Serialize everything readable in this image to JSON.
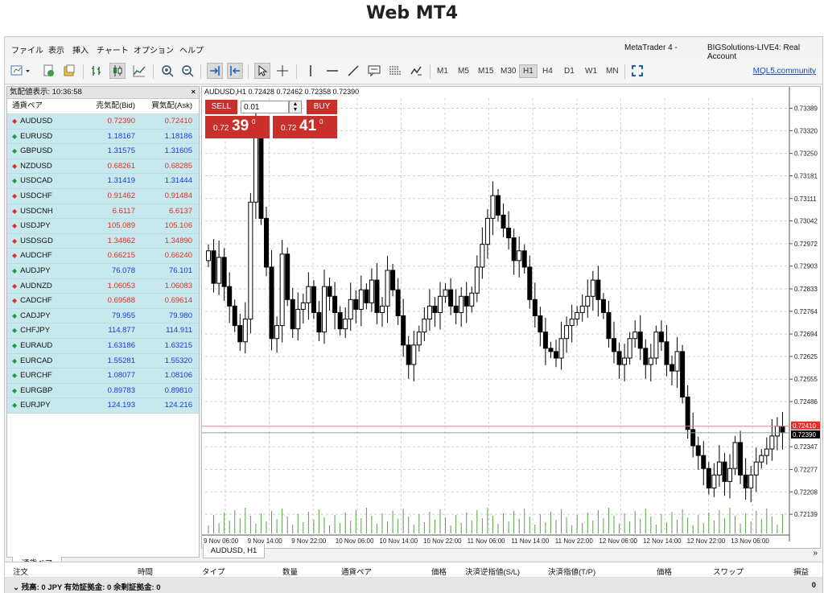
{
  "page_title": "Web MT4",
  "menu": [
    "ファイル",
    "表示",
    "挿入",
    "チャート",
    "オプション",
    "ヘルプ"
  ],
  "account": {
    "platform": "MetaTrader 4 -",
    "server": "BIGSolutions-LIVE4: Real Account"
  },
  "toolbar": {
    "timeframes": [
      "M1",
      "M5",
      "M15",
      "M30",
      "H1",
      "H4",
      "D1",
      "W1",
      "MN"
    ],
    "active_timeframe": "H1",
    "community_link": "MQL5.community"
  },
  "market_watch": {
    "title": "気配値表示: 10:36:58",
    "close": "×",
    "headers": {
      "symbol": "通貨ペア",
      "bid": "売気配(Bid)",
      "ask": "買気配(Ask)"
    },
    "rows": [
      {
        "symbol": "AUDUSD",
        "bid": "0.72390",
        "ask": "0.72410",
        "dir": "down"
      },
      {
        "symbol": "EURUSD",
        "bid": "1.18167",
        "ask": "1.18186",
        "dir": "up"
      },
      {
        "symbol": "GBPUSD",
        "bid": "1.31575",
        "ask": "1.31605",
        "dir": "up"
      },
      {
        "symbol": "NZDUSD",
        "bid": "0.68261",
        "ask": "0.68285",
        "dir": "down"
      },
      {
        "symbol": "USDCAD",
        "bid": "1.31419",
        "ask": "1.31444",
        "dir": "up"
      },
      {
        "symbol": "USDCHF",
        "bid": "0.91462",
        "ask": "0.91484",
        "dir": "down"
      },
      {
        "symbol": "USDCNH",
        "bid": "6.6117",
        "ask": "6.6137",
        "dir": "down"
      },
      {
        "symbol": "USDJPY",
        "bid": "105.089",
        "ask": "105.106",
        "dir": "down"
      },
      {
        "symbol": "USDSGD",
        "bid": "1.34862",
        "ask": "1.34890",
        "dir": "down"
      },
      {
        "symbol": "AUDCHF",
        "bid": "0.66215",
        "ask": "0.66240",
        "dir": "down"
      },
      {
        "symbol": "AUDJPY",
        "bid": "76.078",
        "ask": "76.101",
        "dir": "up"
      },
      {
        "symbol": "AUDNZD",
        "bid": "1.06053",
        "ask": "1.06083",
        "dir": "down"
      },
      {
        "symbol": "CADCHF",
        "bid": "0.69588",
        "ask": "0.69614",
        "dir": "down"
      },
      {
        "symbol": "CADJPY",
        "bid": "79.955",
        "ask": "79.980",
        "dir": "up"
      },
      {
        "symbol": "CHFJPY",
        "bid": "114.877",
        "ask": "114.911",
        "dir": "up"
      },
      {
        "symbol": "EURAUD",
        "bid": "1.63186",
        "ask": "1.63215",
        "dir": "up"
      },
      {
        "symbol": "EURCAD",
        "bid": "1.55281",
        "ask": "1.55320",
        "dir": "up"
      },
      {
        "symbol": "EURCHF",
        "bid": "1.08077",
        "ask": "1.08106",
        "dir": "up"
      },
      {
        "symbol": "EURGBP",
        "bid": "0.89783",
        "ask": "0.89810",
        "dir": "up"
      },
      {
        "symbol": "EURJPY",
        "bid": "124.193",
        "ask": "124.216",
        "dir": "up"
      }
    ],
    "tab": "通貨ペア"
  },
  "chart": {
    "info": "AUDUSD,H1  0.72428 0.72462 0.72358 0.72390",
    "tab": "AUDUSD, H1",
    "one_click": {
      "sell": "SELL",
      "buy": "BUY",
      "lot": "0.01",
      "sell_prefix": "0.72",
      "sell_big": "39",
      "sell_sup": "0",
      "buy_prefix": "0.72",
      "buy_big": "41",
      "buy_sup": "0"
    },
    "ask_label": "0.72410",
    "bid_label": "0.72390"
  },
  "chart_data": {
    "type": "candlestick",
    "symbol": "AUDUSD",
    "timeframe": "H1",
    "y_ticks": [
      "0.73389",
      "0.73320",
      "0.73250",
      "0.73181",
      "0.73111",
      "0.73042",
      "0.72972",
      "0.72903",
      "0.72833",
      "0.72764",
      "0.72694",
      "0.72625",
      "0.72555",
      "0.72486",
      "0.72347",
      "0.72277",
      "0.72208",
      "0.72139"
    ],
    "ylim": [
      0.7208,
      0.7342
    ],
    "x_labels": [
      "9 Nov 06:00",
      "9 Nov 14:00",
      "9 Nov 22:00",
      "10 Nov 06:00",
      "10 Nov 14:00",
      "10 Nov 22:00",
      "11 Nov 06:00",
      "11 Nov 14:00",
      "11 Nov 22:00",
      "12 Nov 06:00",
      "12 Nov 14:00",
      "12 Nov 22:00",
      "13 Nov 06:00"
    ],
    "ask": 0.7241,
    "bid": 0.7239,
    "grid": true,
    "closes": [
      0.7295,
      0.7285,
      0.7293,
      0.7284,
      0.7278,
      0.7272,
      0.7267,
      0.7274,
      0.731,
      0.7333,
      0.7305,
      0.729,
      0.7268,
      0.7272,
      0.7294,
      0.728,
      0.7271,
      0.7277,
      0.7279,
      0.7284,
      0.7276,
      0.727,
      0.7284,
      0.7281,
      0.7276,
      0.7271,
      0.7274,
      0.728,
      0.7277,
      0.7283,
      0.7279,
      0.7286,
      0.7276,
      0.7278,
      0.7289,
      0.7283,
      0.7275,
      0.7266,
      0.726,
      0.7266,
      0.727,
      0.7274,
      0.7278,
      0.7276,
      0.7281,
      0.7283,
      0.7278,
      0.7276,
      0.7281,
      0.7278,
      0.7282,
      0.729,
      0.7297,
      0.7305,
      0.7312,
      0.7306,
      0.7302,
      0.7299,
      0.7292,
      0.7295,
      0.729,
      0.728,
      0.7275,
      0.727,
      0.7265,
      0.7264,
      0.7262,
      0.7268,
      0.7272,
      0.7274,
      0.7276,
      0.7278,
      0.7281,
      0.7286,
      0.728,
      0.7276,
      0.7268,
      0.7264,
      0.726,
      0.7262,
      0.7268,
      0.727,
      0.7265,
      0.726,
      0.7262,
      0.727,
      0.7267,
      0.726,
      0.7258,
      0.7264,
      0.725,
      0.724,
      0.7235,
      0.7232,
      0.7228,
      0.7222,
      0.7226,
      0.723,
      0.7224,
      0.7228,
      0.7236,
      0.7226,
      0.7222,
      0.7226,
      0.723,
      0.7232,
      0.7234,
      0.7238,
      0.7241,
      0.7239
    ]
  },
  "terminal": {
    "headers": [
      "注文",
      "時間",
      "タイプ",
      "数量",
      "通貨ペア",
      "価格",
      "決済逆指値(S/L)",
      "決済指値(T/P)",
      "価格",
      "スワップ",
      "損益"
    ],
    "balance": "残高: 0 JPY  有効証拠金: 0  余剰証拠金: 0",
    "profit": "0"
  },
  "colors": {
    "sell": "#c9302c",
    "down": "#e0302a",
    "up_price": "#1739e0",
    "up_arrow": "#1f9a46",
    "ask_line": "#e88a80",
    "volume": "#5aa04a"
  }
}
